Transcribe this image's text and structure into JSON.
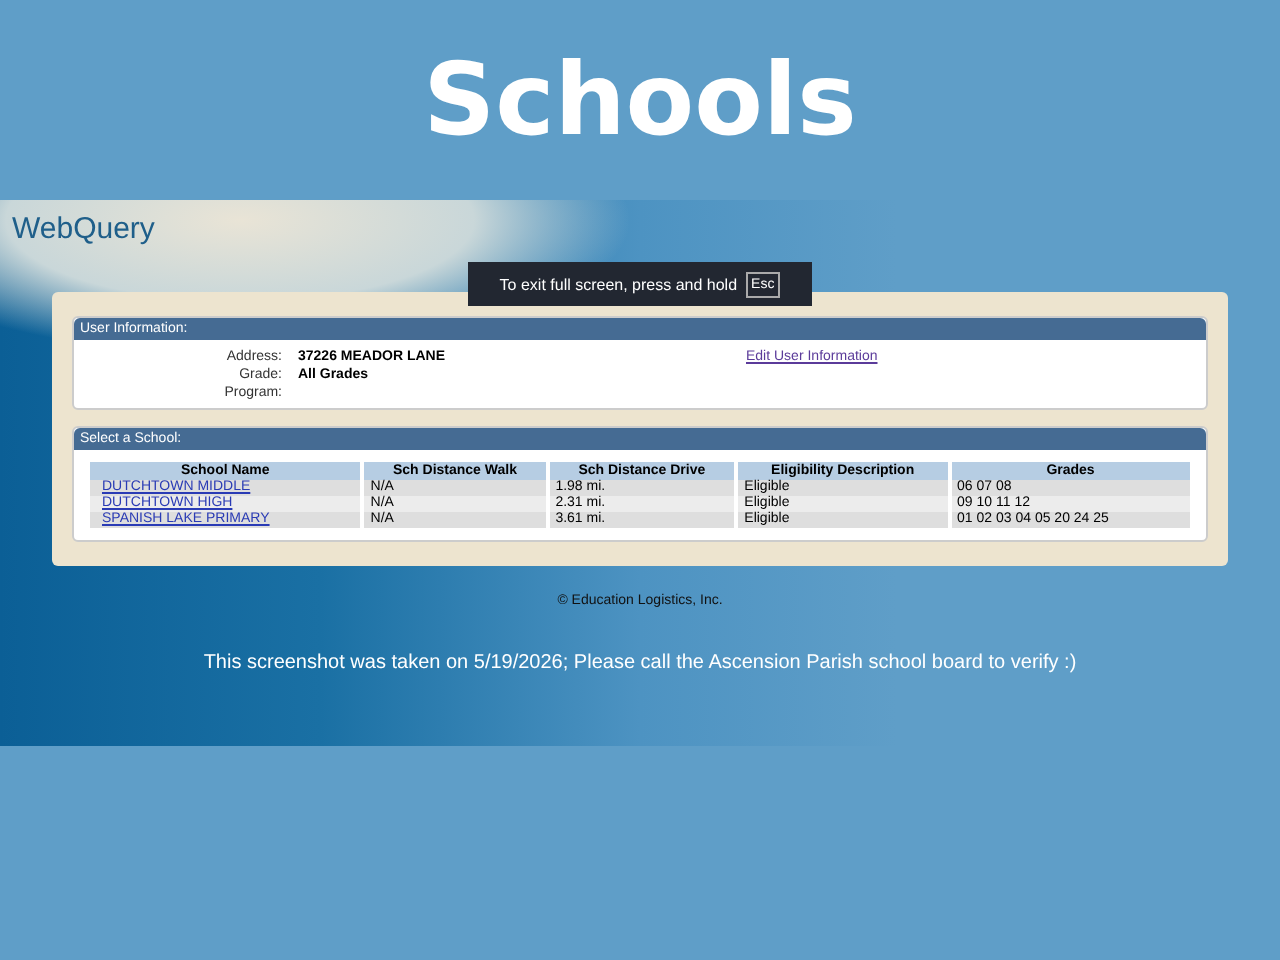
{
  "title": "Schools",
  "app": {
    "name": "WebQuery"
  },
  "toast": {
    "text": "To exit full screen, press and hold",
    "key": "Esc"
  },
  "user_information": {
    "header": "User Information:",
    "fields": [
      {
        "label": "Address:",
        "value": "37226 MEADOR LANE"
      },
      {
        "label": "Grade:",
        "value": "All Grades"
      },
      {
        "label": "Program:"
      }
    ],
    "link": "Edit User Information"
  },
  "select_school": {
    "header": "Select a School:",
    "table": {
      "columns": [
        "School Name",
        "Sch Distance Walk",
        "Sch Distance Drive",
        "Eligibility Description",
        "Grades"
      ],
      "rows": [
        [
          "DUTCHTOWN MIDDLE",
          "N/A",
          "1.98 mi.",
          "Eligible",
          "06 07 08"
        ],
        [
          "DUTCHTOWN HIGH",
          "N/A",
          "2.31 mi.",
          "Eligible",
          "09 10 11 12"
        ],
        [
          "SPANISH LAKE PRIMARY",
          "N/A",
          "3.61 mi.",
          "Eligible",
          "01 02 03 04 05 20 24 25"
        ]
      ]
    }
  },
  "footer": "© Education Logistics, Inc.",
  "note": "This screenshot was taken on 5/19/2026; Please call the Ascension Parish school board to verify :)"
}
